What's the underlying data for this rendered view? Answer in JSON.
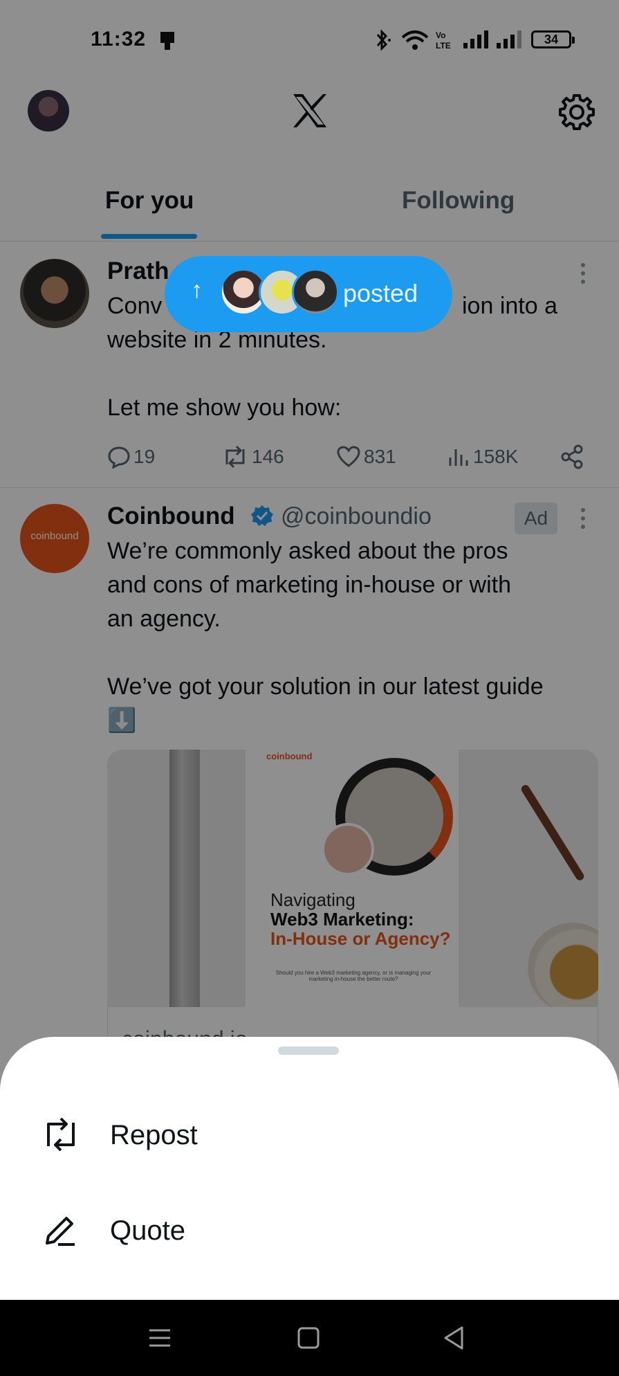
{
  "status_bar": {
    "time": "11:32",
    "battery": "34",
    "icons": [
      "notification-icon",
      "bluetooth-icon",
      "wifi-icon",
      "volte-icon",
      "signal-icon",
      "signal-icon"
    ]
  },
  "header": {
    "logo": "x-logo-icon",
    "settings_icon": "gear-icon"
  },
  "tabs": [
    {
      "label": "For you",
      "active": true
    },
    {
      "label": "Following",
      "active": false
    }
  ],
  "colors": {
    "accent": "#1d9bf0",
    "brand_orange": "#e8541c",
    "text": "#0f1419",
    "muted": "#536471"
  },
  "tweets": [
    {
      "name": "Prath",
      "text_top": "Conv",
      "text_top_right": "ion into a",
      "text": "website in 2 minutes.\n\nLet me show you how:",
      "stats": {
        "replies": "19",
        "reposts": "146",
        "likes": "831",
        "views": "158K"
      }
    },
    {
      "name": "Coinbound",
      "handle": "@coinboundio",
      "ad_label": "Ad",
      "avatar_text": "coinbound",
      "text": "We’re commonly asked about the pros\nand cons of marketing in-house or with\nan agency.\n\nWe’ve got your solution in our latest guide\n⬇️",
      "media": {
        "brand": "coinbound",
        "line1": "Navigating",
        "line2": "Web3 Marketing:",
        "line3": "In-House or Agency?",
        "fine_print": "Should you hire a Web3 marketing agency, or is managing your marketing in-house the better route?"
      },
      "card_domain": "coinbound.io"
    }
  ],
  "new_posts_pill": {
    "label": "posted"
  },
  "sheet": {
    "items": [
      {
        "label": "Repost",
        "icon": "repost-icon"
      },
      {
        "label": "Quote",
        "icon": "pencil-icon"
      }
    ]
  },
  "nav": {
    "buttons": [
      "menu-icon",
      "home-icon",
      "back-icon"
    ]
  }
}
